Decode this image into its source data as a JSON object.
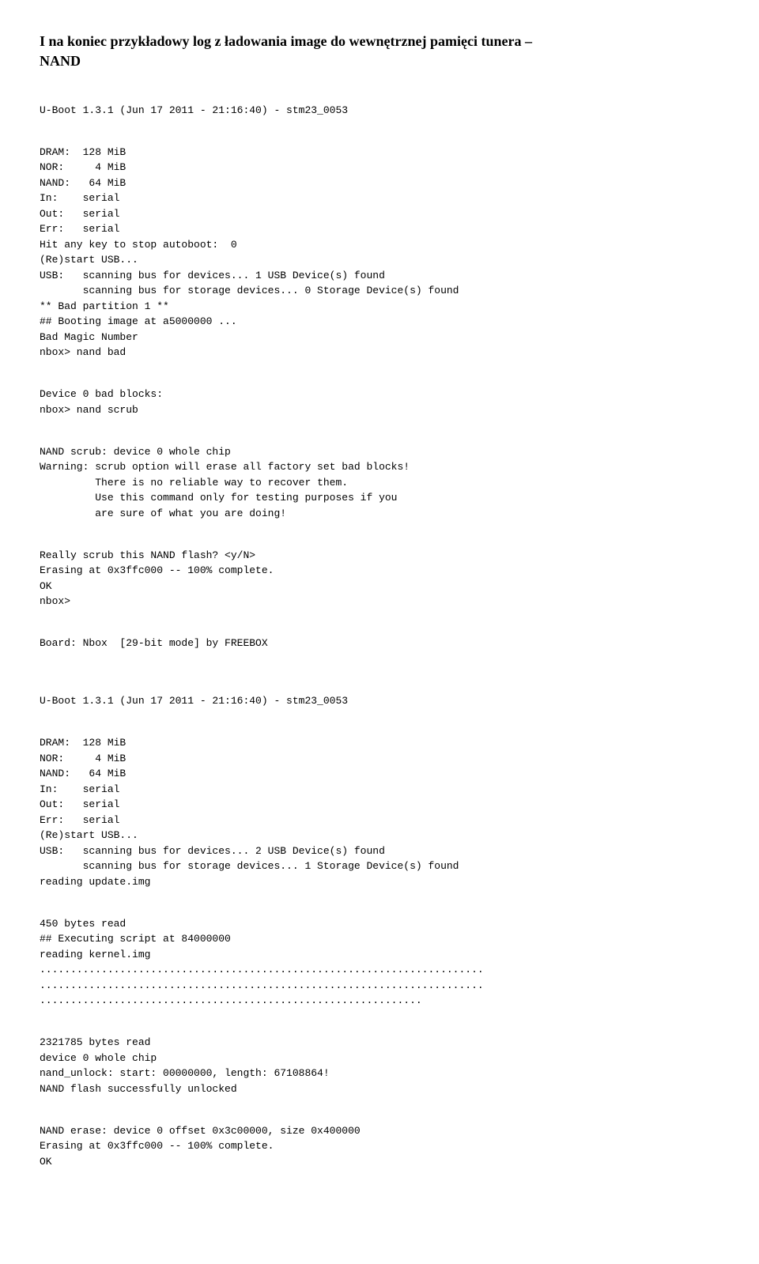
{
  "heading_line1": "I na koniec przykładowy log z ładowania image do wewnętrznej pamięci tunera –",
  "heading_line2": "NAND",
  "log": {
    "l1": "U-Boot 1.3.1 (Jun 17 2011 - 21:16:40) - stm23_0053",
    "l2": "DRAM:  128 MiB",
    "l3": "NOR:     4 MiB",
    "l4": "NAND:   64 MiB",
    "l5": "In:    serial",
    "l6": "Out:   serial",
    "l7": "Err:   serial",
    "l8": "Hit any key to stop autoboot:  0",
    "l9": "(Re)start USB...",
    "l10": "USB:   scanning bus for devices... 1 USB Device(s) found",
    "l11": "       scanning bus for storage devices... 0 Storage Device(s) found",
    "l12": "** Bad partition 1 **",
    "l13": "## Booting image at a5000000 ...",
    "l14": "Bad Magic Number",
    "l15": "nbox> nand bad",
    "l16": "Device 0 bad blocks:",
    "l17": "nbox> nand scrub",
    "l18": "NAND scrub: device 0 whole chip",
    "l19": "Warning: scrub option will erase all factory set bad blocks!",
    "l20": "         There is no reliable way to recover them.",
    "l21": "         Use this command only for testing purposes if you",
    "l22": "         are sure of what you are doing!",
    "l23": "Really scrub this NAND flash? <y/N>",
    "l24": "Erasing at 0x3ffc000 -- 100% complete.",
    "l25": "OK",
    "l26": "nbox>",
    "l27": "Board: Nbox  [29-bit mode] by FREEBOX",
    "l28": "U-Boot 1.3.1 (Jun 17 2011 - 21:16:40) - stm23_0053",
    "l29": "DRAM:  128 MiB",
    "l30": "NOR:     4 MiB",
    "l31": "NAND:   64 MiB",
    "l32": "In:    serial",
    "l33": "Out:   serial",
    "l34": "Err:   serial",
    "l35": "(Re)start USB...",
    "l36": "USB:   scanning bus for devices... 2 USB Device(s) found",
    "l37": "       scanning bus for storage devices... 1 Storage Device(s) found",
    "l38": "reading update.img",
    "l39": "450 bytes read",
    "l40": "## Executing script at 84000000",
    "l41": "reading kernel.img",
    "l42": "........................................................................",
    "l43": "........................................................................",
    "l44": "..............................................................",
    "l45": "2321785 bytes read",
    "l46": "device 0 whole chip",
    "l47": "nand_unlock: start: 00000000, length: 67108864!",
    "l48": "NAND flash successfully unlocked",
    "l49": "NAND erase: device 0 offset 0x3c00000, size 0x400000",
    "l50": "Erasing at 0x3ffc000 -- 100% complete.",
    "l51": "OK"
  }
}
